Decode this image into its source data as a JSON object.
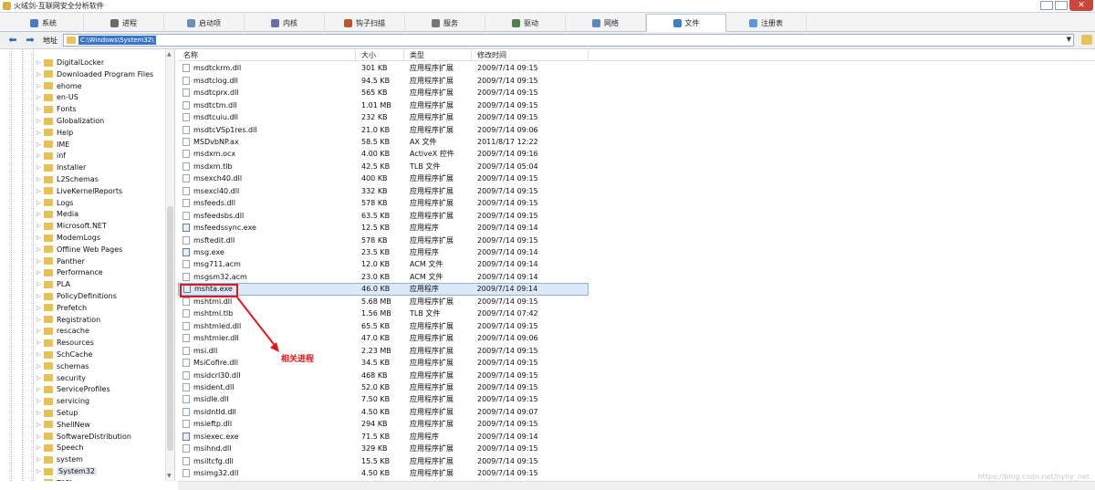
{
  "window": {
    "title": "火绒剑-互联网安全分析软件",
    "close_label": "✕"
  },
  "tabs": [
    {
      "label": "系统",
      "color": "#4a7bc4"
    },
    {
      "label": "进程",
      "color": "#6b6b6b"
    },
    {
      "label": "启动项",
      "color": "#6a8fb8"
    },
    {
      "label": "内核",
      "color": "#6b6bb0"
    },
    {
      "label": "钩子扫描",
      "color": "#c0552d"
    },
    {
      "label": "服务",
      "color": "#777777"
    },
    {
      "label": "驱动",
      "color": "#4f7f4f"
    },
    {
      "label": "网络",
      "color": "#5a88c0"
    },
    {
      "label": "文件",
      "color": "#3f7fc7",
      "active": true
    },
    {
      "label": "注册表",
      "color": "#5a9ad8"
    }
  ],
  "address": {
    "label": "地址",
    "value": "C:\\Windows\\System32\\"
  },
  "tree": {
    "items": [
      "DigitalLocker",
      "Downloaded Program Files",
      "ehome",
      "en-US",
      "Fonts",
      "Globalization",
      "Help",
      "IME",
      "inf",
      "Installer",
      "L2Schemas",
      "LiveKernelReports",
      "Logs",
      "Media",
      "Microsoft.NET",
      "ModemLogs",
      "Offline Web Pages",
      "Panther",
      "Performance",
      "PLA",
      "PolicyDefinitions",
      "Prefetch",
      "Registration",
      "rescache",
      "Resources",
      "SchCache",
      "schemas",
      "security",
      "ServiceProfiles",
      "servicing",
      "Setup",
      "ShellNew",
      "SoftwareDistribution",
      "Speech",
      "system",
      "System32",
      "TAPI"
    ],
    "selected": "System32"
  },
  "columns": {
    "name": "名称",
    "size": "大小",
    "type": "类型",
    "date": "修改时间"
  },
  "files": [
    {
      "name": "msdtckrm.dll",
      "size": "301 KB",
      "type": "应用程序扩展",
      "date": "2009/7/14 09:15"
    },
    {
      "name": "msdtclog.dll",
      "size": "94.5 KB",
      "type": "应用程序扩展",
      "date": "2009/7/14 09:15"
    },
    {
      "name": "msdtcprx.dll",
      "size": "565 KB",
      "type": "应用程序扩展",
      "date": "2009/7/14 09:15"
    },
    {
      "name": "msdtctm.dll",
      "size": "1.01 MB",
      "type": "应用程序扩展",
      "date": "2009/7/14 09:15"
    },
    {
      "name": "msdtcuiu.dll",
      "size": "232 KB",
      "type": "应用程序扩展",
      "date": "2009/7/14 09:15"
    },
    {
      "name": "msdtcVSp1res.dll",
      "size": "21.0 KB",
      "type": "应用程序扩展",
      "date": "2009/7/14 09:06"
    },
    {
      "name": "MSDvbNP.ax",
      "size": "58.5 KB",
      "type": "AX 文件",
      "date": "2011/8/17 12:22"
    },
    {
      "name": "msdxm.ocx",
      "size": "4.00 KB",
      "type": "ActiveX 控件",
      "date": "2009/7/14 09:16"
    },
    {
      "name": "msdxm.tlb",
      "size": "42.5 KB",
      "type": "TLB 文件",
      "date": "2009/7/14 05:04"
    },
    {
      "name": "msexch40.dll",
      "size": "400 KB",
      "type": "应用程序扩展",
      "date": "2009/7/14 09:15"
    },
    {
      "name": "msexcl40.dll",
      "size": "332 KB",
      "type": "应用程序扩展",
      "date": "2009/7/14 09:15"
    },
    {
      "name": "msfeeds.dll",
      "size": "578 KB",
      "type": "应用程序扩展",
      "date": "2009/7/14 09:15"
    },
    {
      "name": "msfeedsbs.dll",
      "size": "63.5 KB",
      "type": "应用程序扩展",
      "date": "2009/7/14 09:15"
    },
    {
      "name": "msfeedssync.exe",
      "size": "12.5 KB",
      "type": "应用程序",
      "date": "2009/7/14 09:14",
      "exe": true
    },
    {
      "name": "msftedit.dll",
      "size": "578 KB",
      "type": "应用程序扩展",
      "date": "2009/7/14 09:15"
    },
    {
      "name": "msg.exe",
      "size": "23.5 KB",
      "type": "应用程序",
      "date": "2009/7/14 09:14",
      "exe": true
    },
    {
      "name": "msg711.acm",
      "size": "12.0 KB",
      "type": "ACM 文件",
      "date": "2009/7/14 09:14"
    },
    {
      "name": "msgsm32.acm",
      "size": "23.0 KB",
      "type": "ACM 文件",
      "date": "2009/7/14 09:14"
    },
    {
      "name": "mshta.exe",
      "size": "46.0 KB",
      "type": "应用程序",
      "date": "2009/7/14 09:14",
      "exe": true,
      "selected": true
    },
    {
      "name": "mshtml.dll",
      "size": "5.68 MB",
      "type": "应用程序扩展",
      "date": "2009/7/14 09:15"
    },
    {
      "name": "mshtml.tlb",
      "size": "1.56 MB",
      "type": "TLB 文件",
      "date": "2009/7/14 07:42"
    },
    {
      "name": "mshtmled.dll",
      "size": "65.5 KB",
      "type": "应用程序扩展",
      "date": "2009/7/14 09:15"
    },
    {
      "name": "mshtmler.dll",
      "size": "47.0 KB",
      "type": "应用程序扩展",
      "date": "2009/7/14 09:06"
    },
    {
      "name": "msi.dll",
      "size": "2.23 MB",
      "type": "应用程序扩展",
      "date": "2009/7/14 09:15"
    },
    {
      "name": "MsiCofire.dll",
      "size": "34.5 KB",
      "type": "应用程序扩展",
      "date": "2009/7/14 09:15"
    },
    {
      "name": "msidcrl30.dll",
      "size": "468 KB",
      "type": "应用程序扩展",
      "date": "2009/7/14 09:15"
    },
    {
      "name": "msident.dll",
      "size": "52.0 KB",
      "type": "应用程序扩展",
      "date": "2009/7/14 09:15"
    },
    {
      "name": "msidle.dll",
      "size": "7.50 KB",
      "type": "应用程序扩展",
      "date": "2009/7/14 09:15"
    },
    {
      "name": "msidntld.dll",
      "size": "4.50 KB",
      "type": "应用程序扩展",
      "date": "2009/7/14 09:07"
    },
    {
      "name": "msieftp.dll",
      "size": "294 KB",
      "type": "应用程序扩展",
      "date": "2009/7/14 09:15"
    },
    {
      "name": "msiexec.exe",
      "size": "71.5 KB",
      "type": "应用程序",
      "date": "2009/7/14 09:14",
      "exe": true
    },
    {
      "name": "msihnd.dll",
      "size": "329 KB",
      "type": "应用程序扩展",
      "date": "2009/7/14 09:15"
    },
    {
      "name": "msiltcfg.dll",
      "size": "15.5 KB",
      "type": "应用程序扩展",
      "date": "2009/7/14 09:15"
    },
    {
      "name": "msimg32.dll",
      "size": "4.50 KB",
      "type": "应用程序扩展",
      "date": "2009/7/14 09:15"
    }
  ],
  "annotation": {
    "text": "相关进程",
    "color": "#e0181c"
  },
  "watermark": "https://blog.csdn.net/hyhy_net"
}
